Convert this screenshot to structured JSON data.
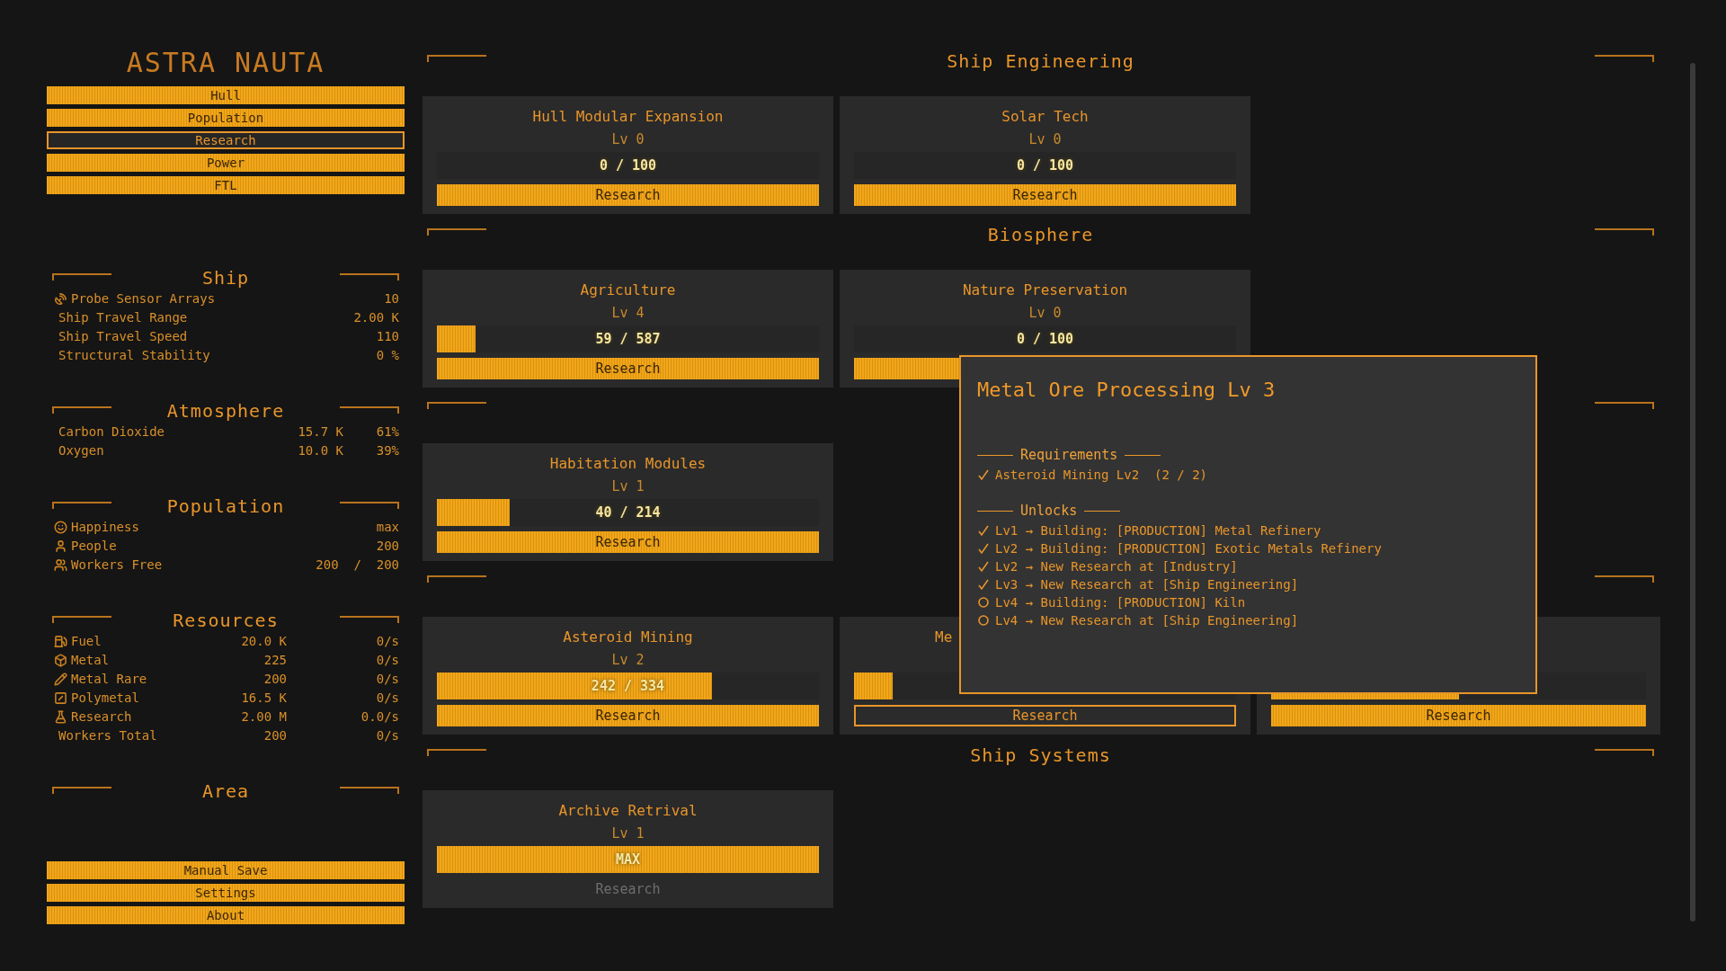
{
  "sidebar": {
    "title": "ASTRA NAUTA",
    "nav": [
      {
        "label": "Hull",
        "selected": false
      },
      {
        "label": "Population",
        "selected": false
      },
      {
        "label": "Research",
        "selected": true
      },
      {
        "label": "Power",
        "selected": false
      },
      {
        "label": "FTL",
        "selected": false
      }
    ],
    "sections": [
      {
        "title": "Ship",
        "kind": "single",
        "rows": [
          {
            "label": "Probe Sensor Arrays",
            "values": [
              "10"
            ]
          },
          {
            "label": "Ship Travel Range",
            "values": [
              "2.00 K"
            ]
          },
          {
            "label": "Ship Travel Speed",
            "values": [
              "110"
            ]
          },
          {
            "label": "Structural Stability",
            "values": [
              "0 %"
            ]
          }
        ]
      },
      {
        "title": "Atmosphere",
        "kind": "percent",
        "rows": [
          {
            "label": "Carbon Dioxide",
            "values": [
              "15.7 K",
              "61%"
            ]
          },
          {
            "label": "Oxygen",
            "values": [
              "10.0 K",
              "39%"
            ]
          }
        ]
      },
      {
        "title": "Population",
        "kind": "single",
        "rows": [
          {
            "label": "Happiness",
            "values": [
              "max"
            ]
          },
          {
            "label": "People",
            "values": [
              "200"
            ]
          },
          {
            "label": "Workers Free",
            "values": [
              "200  /  200"
            ]
          }
        ]
      },
      {
        "title": "Resources",
        "kind": "rate",
        "rows": [
          {
            "label": "Fuel",
            "values": [
              "20.0 K",
              "0/s"
            ]
          },
          {
            "label": "Metal",
            "values": [
              "225",
              "0/s"
            ]
          },
          {
            "label": "Metal Rare",
            "values": [
              "200",
              "0/s"
            ]
          },
          {
            "label": "Polymetal",
            "values": [
              "16.5 K",
              "0/s"
            ]
          },
          {
            "label": "Research",
            "values": [
              "2.00 M",
              "0.0/s"
            ]
          },
          {
            "label": "Workers Total",
            "values": [
              "200",
              "0/s"
            ]
          }
        ]
      },
      {
        "title": "Area",
        "kind": "single"
      }
    ],
    "footer_buttons": [
      "Manual Save",
      "Settings",
      "About"
    ]
  },
  "main": {
    "sections": [
      {
        "title": "Ship Engineering",
        "cards": [
          {
            "title": "Hull Modular Expansion",
            "level_label": "Lv 0",
            "progress": {
              "level": 0,
              "text": "0 / 100"
            },
            "button": {
              "label": "Research",
              "selected": false,
              "disabled": false
            }
          },
          {
            "title": "Solar Tech",
            "level_label": "Lv 0",
            "progress": {
              "level": 0,
              "text": "0 / 100"
            },
            "button": {
              "label": "Research",
              "selected": false,
              "disabled": false
            }
          }
        ]
      },
      {
        "title": "Biosphere",
        "cards": [
          {
            "title": "Agriculture",
            "level_label": "Lv 4",
            "progress": {
              "level": 0.1,
              "text": "59 / 587"
            },
            "button": {
              "label": "Research",
              "selected": false,
              "disabled": false
            }
          },
          {
            "title": "Nature Preservation",
            "level_label": "Lv 0",
            "progress": {
              "level": 0,
              "text": "0 / 100"
            },
            "button": {
              "selected": false,
              "disabled": false
            }
          }
        ]
      },
      {
        "cards": [
          {
            "title": "Habitation Modules",
            "level_label": "Lv 1",
            "progress": {
              "level": 0.19,
              "text": "40 / 214"
            },
            "button": {
              "label": "Research",
              "selected": false,
              "disabled": false
            }
          }
        ]
      },
      {
        "cards": [
          {
            "title": "Asteroid Mining",
            "level_label": "Lv 2",
            "progress": {
              "level": 0.72,
              "text": "242 / 334"
            },
            "button": {
              "label": "Research",
              "selected": false,
              "disabled": false
            }
          },
          {
            "title": "Me",
            "kind": "covered",
            "progress": {
              "level": 0.1
            },
            "button": {
              "label": "Research",
              "selected": true,
              "disabled": false
            }
          },
          {
            "kind": "covered",
            "progress": {
              "level": 0.5
            },
            "button": {
              "label": "Research",
              "selected": false,
              "disabled": false
            }
          }
        ]
      },
      {
        "title": "Ship Systems",
        "cards": [
          {
            "title": "Archive Retrival",
            "level_label": "Lv 1",
            "progress": {
              "level": 1,
              "text": "MAX"
            },
            "button": {
              "label": "Research",
              "selected": false,
              "disabled": true
            }
          }
        ]
      }
    ]
  },
  "tooltip": {
    "title": "Metal Ore Processing Lv 3",
    "sections": [
      {
        "heading": "Requirements",
        "items": [
          {
            "text": "Asteroid Mining Lv2  (2 / 2)",
            "done": true
          }
        ]
      },
      {
        "heading": "Unlocks",
        "items": [
          {
            "text": "Lv1 → Building: [PRODUCTION] Metal Refinery",
            "done": true
          },
          {
            "text": "Lv2 → Building: [PRODUCTION] Exotic Metals Refinery",
            "done": true
          },
          {
            "text": "Lv2 → New Research at [Industry]",
            "done": true
          },
          {
            "text": "Lv3 → New Research at [Ship Engineering]",
            "done": true
          },
          {
            "text": "Lv4 → Building: [PRODUCTION] Kiln",
            "done": false
          },
          {
            "text": "Lv4 → New Research at [Ship Engineering]",
            "done": false
          }
        ]
      }
    ]
  }
}
